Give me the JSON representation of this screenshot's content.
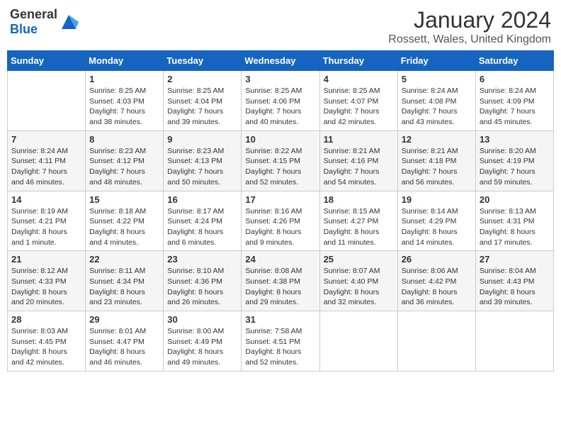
{
  "header": {
    "logo_general": "General",
    "logo_blue": "Blue",
    "main_title": "January 2024",
    "subtitle": "Rossett, Wales, United Kingdom"
  },
  "columns": [
    "Sunday",
    "Monday",
    "Tuesday",
    "Wednesday",
    "Thursday",
    "Friday",
    "Saturday"
  ],
  "weeks": [
    [
      {
        "day": "",
        "info": ""
      },
      {
        "day": "1",
        "info": "Sunrise: 8:25 AM\nSunset: 4:03 PM\nDaylight: 7 hours\nand 38 minutes."
      },
      {
        "day": "2",
        "info": "Sunrise: 8:25 AM\nSunset: 4:04 PM\nDaylight: 7 hours\nand 39 minutes."
      },
      {
        "day": "3",
        "info": "Sunrise: 8:25 AM\nSunset: 4:06 PM\nDaylight: 7 hours\nand 40 minutes."
      },
      {
        "day": "4",
        "info": "Sunrise: 8:25 AM\nSunset: 4:07 PM\nDaylight: 7 hours\nand 42 minutes."
      },
      {
        "day": "5",
        "info": "Sunrise: 8:24 AM\nSunset: 4:08 PM\nDaylight: 7 hours\nand 43 minutes."
      },
      {
        "day": "6",
        "info": "Sunrise: 8:24 AM\nSunset: 4:09 PM\nDaylight: 7 hours\nand 45 minutes."
      }
    ],
    [
      {
        "day": "7",
        "info": "Sunrise: 8:24 AM\nSunset: 4:11 PM\nDaylight: 7 hours\nand 46 minutes."
      },
      {
        "day": "8",
        "info": "Sunrise: 8:23 AM\nSunset: 4:12 PM\nDaylight: 7 hours\nand 48 minutes."
      },
      {
        "day": "9",
        "info": "Sunrise: 8:23 AM\nSunset: 4:13 PM\nDaylight: 7 hours\nand 50 minutes."
      },
      {
        "day": "10",
        "info": "Sunrise: 8:22 AM\nSunset: 4:15 PM\nDaylight: 7 hours\nand 52 minutes."
      },
      {
        "day": "11",
        "info": "Sunrise: 8:21 AM\nSunset: 4:16 PM\nDaylight: 7 hours\nand 54 minutes."
      },
      {
        "day": "12",
        "info": "Sunrise: 8:21 AM\nSunset: 4:18 PM\nDaylight: 7 hours\nand 56 minutes."
      },
      {
        "day": "13",
        "info": "Sunrise: 8:20 AM\nSunset: 4:19 PM\nDaylight: 7 hours\nand 59 minutes."
      }
    ],
    [
      {
        "day": "14",
        "info": "Sunrise: 8:19 AM\nSunset: 4:21 PM\nDaylight: 8 hours\nand 1 minute."
      },
      {
        "day": "15",
        "info": "Sunrise: 8:18 AM\nSunset: 4:22 PM\nDaylight: 8 hours\nand 4 minutes."
      },
      {
        "day": "16",
        "info": "Sunrise: 8:17 AM\nSunset: 4:24 PM\nDaylight: 8 hours\nand 6 minutes."
      },
      {
        "day": "17",
        "info": "Sunrise: 8:16 AM\nSunset: 4:26 PM\nDaylight: 8 hours\nand 9 minutes."
      },
      {
        "day": "18",
        "info": "Sunrise: 8:15 AM\nSunset: 4:27 PM\nDaylight: 8 hours\nand 11 minutes."
      },
      {
        "day": "19",
        "info": "Sunrise: 8:14 AM\nSunset: 4:29 PM\nDaylight: 8 hours\nand 14 minutes."
      },
      {
        "day": "20",
        "info": "Sunrise: 8:13 AM\nSunset: 4:31 PM\nDaylight: 8 hours\nand 17 minutes."
      }
    ],
    [
      {
        "day": "21",
        "info": "Sunrise: 8:12 AM\nSunset: 4:33 PM\nDaylight: 8 hours\nand 20 minutes."
      },
      {
        "day": "22",
        "info": "Sunrise: 8:11 AM\nSunset: 4:34 PM\nDaylight: 8 hours\nand 23 minutes."
      },
      {
        "day": "23",
        "info": "Sunrise: 8:10 AM\nSunset: 4:36 PM\nDaylight: 8 hours\nand 26 minutes."
      },
      {
        "day": "24",
        "info": "Sunrise: 8:08 AM\nSunset: 4:38 PM\nDaylight: 8 hours\nand 29 minutes."
      },
      {
        "day": "25",
        "info": "Sunrise: 8:07 AM\nSunset: 4:40 PM\nDaylight: 8 hours\nand 32 minutes."
      },
      {
        "day": "26",
        "info": "Sunrise: 8:06 AM\nSunset: 4:42 PM\nDaylight: 8 hours\nand 36 minutes."
      },
      {
        "day": "27",
        "info": "Sunrise: 8:04 AM\nSunset: 4:43 PM\nDaylight: 8 hours\nand 39 minutes."
      }
    ],
    [
      {
        "day": "28",
        "info": "Sunrise: 8:03 AM\nSunset: 4:45 PM\nDaylight: 8 hours\nand 42 minutes."
      },
      {
        "day": "29",
        "info": "Sunrise: 8:01 AM\nSunset: 4:47 PM\nDaylight: 8 hours\nand 46 minutes."
      },
      {
        "day": "30",
        "info": "Sunrise: 8:00 AM\nSunset: 4:49 PM\nDaylight: 8 hours\nand 49 minutes."
      },
      {
        "day": "31",
        "info": "Sunrise: 7:58 AM\nSunset: 4:51 PM\nDaylight: 8 hours\nand 52 minutes."
      },
      {
        "day": "",
        "info": ""
      },
      {
        "day": "",
        "info": ""
      },
      {
        "day": "",
        "info": ""
      }
    ]
  ]
}
